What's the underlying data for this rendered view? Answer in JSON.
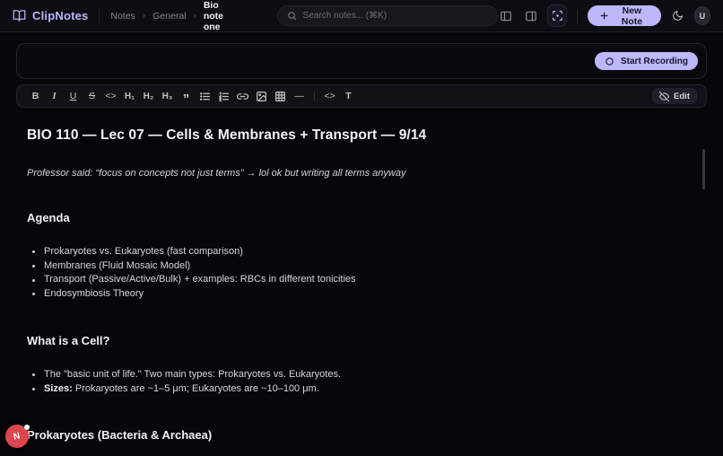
{
  "colors": {
    "accent": "#bcb8f9",
    "accent_text": "#17172b",
    "record_bubble": "#da454e",
    "bg_main": "#07070a"
  },
  "header": {
    "app_name": "ClipNotes",
    "breadcrumb_separator": "›",
    "breadcrumbs": [
      "Notes",
      "General",
      "Bio note one"
    ],
    "search_placeholder": "Search notes... (⌘K)",
    "new_note_label": "New Note",
    "user_avatar_initial": "U"
  },
  "recording": {
    "start_label": "Start Recording"
  },
  "toolbar": {
    "glyphs": {
      "bold": "B",
      "italic": "I",
      "underline": "U",
      "strike": "S",
      "code": "<>",
      "h1": "H₁",
      "h2": "H₂",
      "h3": "H₃",
      "quote": "”",
      "hr": "—",
      "codeblock": "<>",
      "text": "T"
    },
    "edit_label": "Edit"
  },
  "document": {
    "title": "BIO 110 — Lec 07 — Cells & Membranes + Transport — 9/14",
    "note": "Professor said: “focus on concepts not just terms” → lol ok but writing all terms anyway",
    "sections": [
      {
        "heading": "Agenda",
        "bullets": [
          {
            "text": "Prokaryotes vs. Eukaryotes (fast comparison)"
          },
          {
            "text": "Membranes (Fluid Mosaic Model)"
          },
          {
            "text": "Transport (Passive/Active/Bulk) + examples: RBCs in different tonicities"
          },
          {
            "text": "Endosymbiosis Theory"
          }
        ]
      },
      {
        "heading": "What is a Cell?",
        "bullets": [
          {
            "text": "The \"basic unit of life.\" Two main types: Prokaryotes vs. Eukaryotes."
          },
          {
            "bold": "Sizes:",
            "text": " Prokaryotes are ~1–5 μm; Eukaryotes are ~10–100 μm."
          }
        ]
      },
      {
        "heading": "Prokaryotes (Bacteria & Archaea)",
        "bullets": []
      }
    ]
  },
  "floating": {
    "avatar_initial": "N"
  }
}
